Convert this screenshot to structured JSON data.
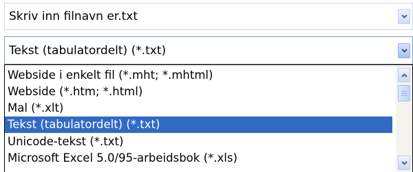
{
  "filename_field": {
    "value": "Skriv inn filnavn er.txt"
  },
  "filetype_select": {
    "selected": "Tekst (tabulatordelt) (*.txt)"
  },
  "filetype_list": {
    "items": [
      {
        "label": "Webside i enkelt fil (*.mht; *.mhtml)"
      },
      {
        "label": "Webside (*.htm; *.html)"
      },
      {
        "label": "Mal (*.xlt)"
      },
      {
        "label": "Tekst (tabulatordelt) (*.txt)"
      },
      {
        "label": "Unicode-tekst (*.txt)"
      },
      {
        "label": "Microsoft Excel 5.0/95-arbeidsbok (*.xls)"
      }
    ],
    "selected_index": 3
  },
  "colors": {
    "selection": "#316ac5",
    "selection_text": "#ffffff",
    "border": "#7f9db9",
    "scrollbar_track": "#f4f3ee",
    "chevron": "#4d6185"
  },
  "icons": {
    "dropdown": "chevron-down-icon",
    "scroll_up": "chevron-up-icon",
    "scroll_down": "chevron-down-icon"
  }
}
